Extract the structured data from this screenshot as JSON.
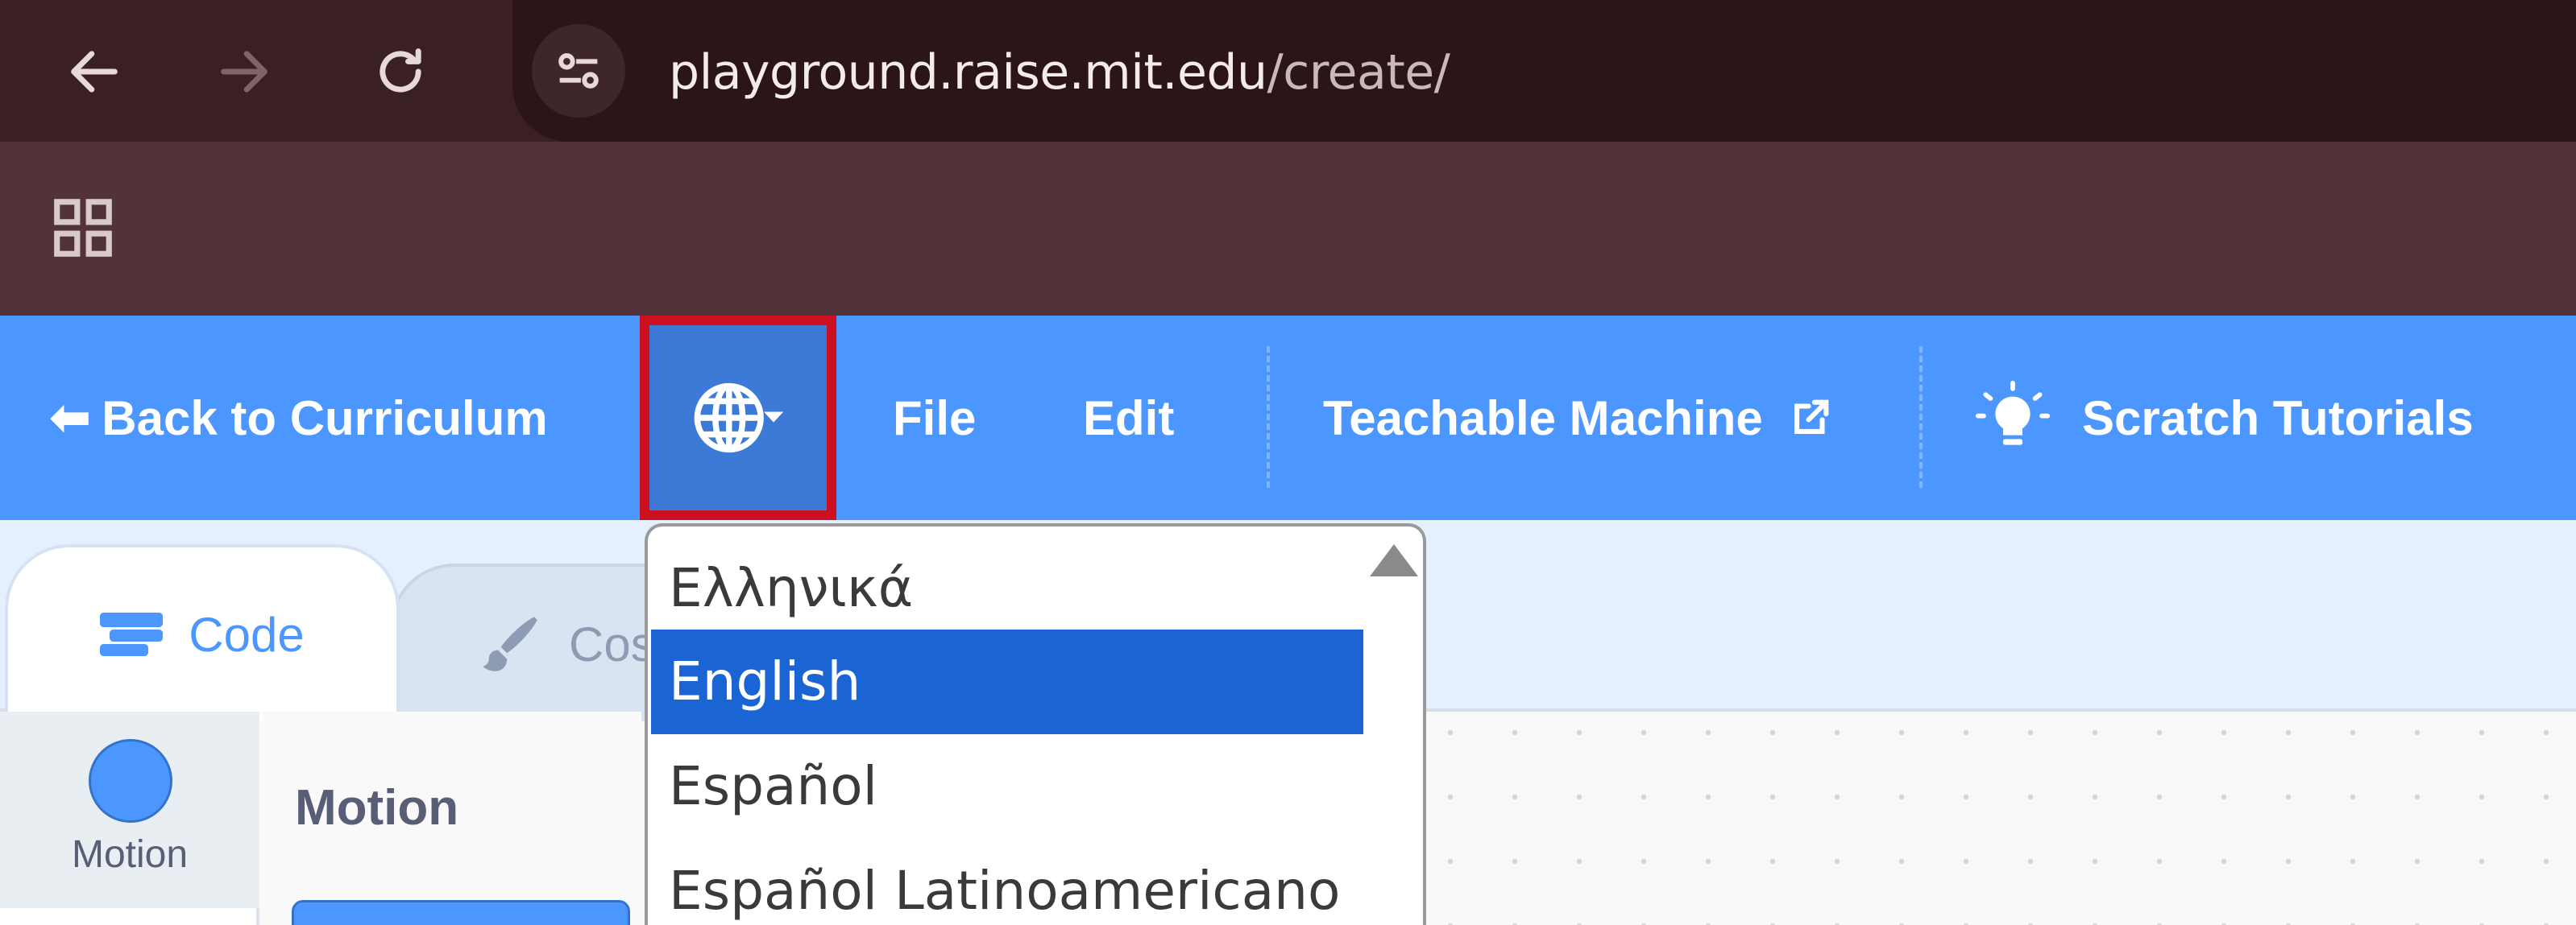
{
  "browser": {
    "url_host": "playground.raise.mit.edu",
    "url_path": "/create/",
    "icons": [
      "back-arrow-icon",
      "forward-arrow-icon",
      "reload-icon",
      "site-settings-icon",
      "apps-grid-icon"
    ]
  },
  "menubar": {
    "back_label": "Back to Curriculum",
    "file_label": "File",
    "edit_label": "Edit",
    "teachable_label": "Teachable Machine",
    "tutorials_label": "Scratch Tutorials",
    "icons": [
      "globe-icon",
      "caret-down-icon",
      "external-link-icon",
      "lightbulb-icon"
    ]
  },
  "tabs": {
    "code_label": "Code",
    "costumes_label": "Cos"
  },
  "categories": {
    "motion_label": "Motion"
  },
  "flyout": {
    "title": "Motion"
  },
  "language_menu": {
    "selected": "English",
    "options": [
      "Ελληνικά",
      "English",
      "Español",
      "Español Latinoamericano"
    ]
  },
  "colors": {
    "menubar": "#4c97ff",
    "selection": "#1a64d4",
    "highlight_border": "#cc1020",
    "chrome_dark": "#3a1f24"
  }
}
